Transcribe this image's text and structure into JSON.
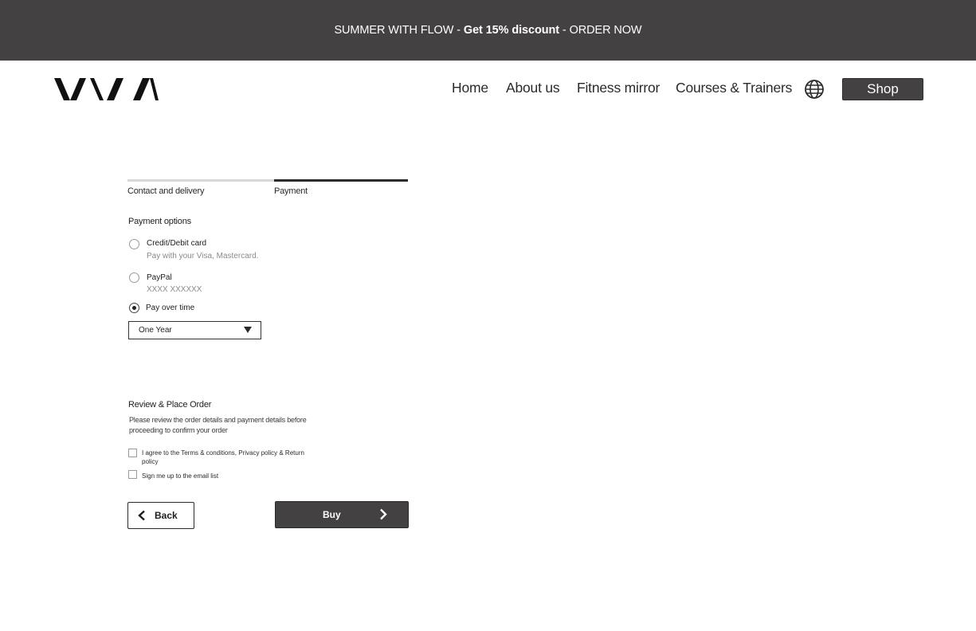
{
  "promo": {
    "prefix": "SUMMER WITH FLOW - ",
    "highlight": "Get 15% discount",
    "suffix": " - ORDER NOW"
  },
  "header": {
    "logo_icon": "brand-logo",
    "nav": {
      "home": "Home",
      "about": "About us",
      "mirror": "Fitness mirror",
      "courses": "Courses & Trainers"
    },
    "language_icon": "globe-icon",
    "shop_label": "Shop"
  },
  "checkout": {
    "steps": [
      {
        "label": "Contact and delivery",
        "active": false
      },
      {
        "label": "Payment",
        "active": true
      }
    ],
    "payment": {
      "title": "Payment options",
      "options": [
        {
          "label": "Credit/Debit card",
          "description": "Pay with your Visa, Mastercard.",
          "selected": false
        },
        {
          "label": "PayPal",
          "description": "XXXX XXXXXX",
          "selected": false
        },
        {
          "label": "Pay over time",
          "selected": true
        }
      ],
      "term_select": {
        "value": "One Year"
      }
    },
    "review": {
      "title": "Review & Place Order",
      "description": "Please review the order details and payment details before proceeding to confirm your order",
      "terms_checkbox": {
        "label": "I agree to the Terms & conditions, Privacy policy & Return policy",
        "checked": false
      },
      "email_checkbox": {
        "label": "Sign me up to the email list",
        "checked": false
      }
    },
    "actions": {
      "back_label": "Back",
      "buy_label": "Buy",
      "back_icon": "chevron-left-icon",
      "buy_icon": "chevron-right-icon"
    }
  },
  "colors": {
    "promo_background": "#434142",
    "button_dark": "#434142",
    "active_step": "#2b2b2b",
    "inactive_step": "#d8d8d8"
  }
}
